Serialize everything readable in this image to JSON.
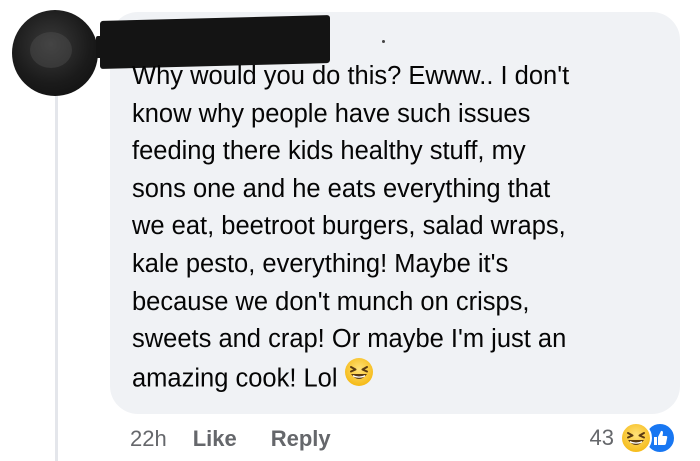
{
  "comment": {
    "author_name_redacted": true,
    "lines": [
      "Why would you do this? Ewww.. I don't",
      "know why people have such issues",
      "feeding there kids healthy stuff, my",
      "sons one and he eats everything that",
      "we eat, beetroot burgers, salad wraps,",
      "kale pesto, everything! Maybe it's",
      "because we don't munch on crisps,",
      "sweets and crap! Or maybe I'm just an",
      "amazing cook! Lol"
    ],
    "trailing_emoji": "laughing-face-icon"
  },
  "actions": {
    "timestamp": "22h",
    "like_label": "Like",
    "reply_label": "Reply"
  },
  "reactions": {
    "count": "43",
    "icons": [
      "haha-reaction-icon",
      "like-reaction-icon"
    ]
  },
  "colors": {
    "bubble_bg": "#f0f2f5",
    "secondary_text": "#65676b",
    "like_blue": "#1877f2",
    "haha_yellow": "#f7c94b"
  }
}
